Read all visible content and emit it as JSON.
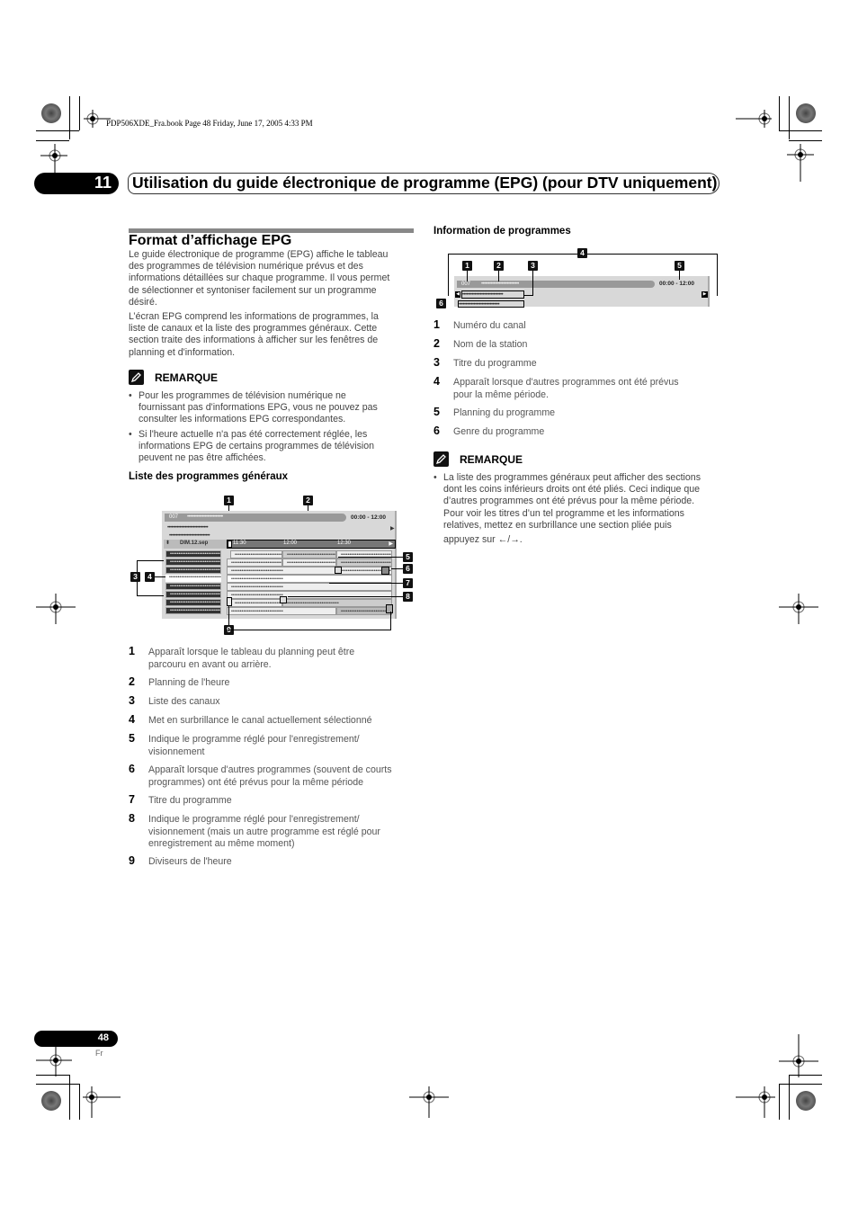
{
  "header": {
    "book_info": "PDP506XDE_Fra.book  Page 48  Friday, June 17, 2005  4:33 PM",
    "chapter_number": "11",
    "chapter_title": "Utilisation du guide électronique de programme (EPG) (pour DTV uniquement)"
  },
  "left": {
    "section_title": "Format d’affichage EPG",
    "intro_lines": [
      "Le guide électronique de programme (EPG) affiche le tableau",
      "des programmes de télévision numérique prévus et des",
      "informations détaillées sur chaque programme. Il vous permet",
      "de sélectionner et syntoniser facilement sur un programme",
      "désiré."
    ],
    "intro2_lines": [
      "L’écran EPG comprend les informations de programmes, la",
      "liste de canaux et la liste des programmes généraux. Cette",
      "section traite des informations à afficher sur les fenêtres de",
      "planning et d'information."
    ],
    "note_label": "REMARQUE",
    "note_bullets": [
      [
        "Pour les programmes de télévision numérique ne",
        "fournissant pas d'informations EPG, vous ne pouvez pas",
        "consulter les informations EPG correspondantes."
      ],
      [
        "Si l'heure actuelle n'a pas été correctement réglée, les",
        "informations EPG de certains programmes de télévision",
        "peuvent ne pas être affichées."
      ]
    ],
    "subhead": "Liste des programmes généraux",
    "diagram": {
      "channel": "007",
      "time_range": "00:00 - 12:00",
      "date": "DIM.12.sep",
      "times": [
        "11:30",
        "12:00",
        "12:30"
      ],
      "dotted": "••••••••••••••••••••••••••••••",
      "callouts": [
        "1",
        "2",
        "3",
        "4",
        "5",
        "6",
        "7",
        "8",
        "9"
      ]
    },
    "items": [
      {
        "num": "1",
        "lines": [
          "Apparaît lorsque le tableau du planning peut être",
          "parcouru en avant ou arrière."
        ]
      },
      {
        "num": "2",
        "lines": [
          "Planning de l'heure"
        ]
      },
      {
        "num": "3",
        "lines": [
          "Liste des canaux"
        ]
      },
      {
        "num": "4",
        "lines": [
          "Met en surbrillance le canal actuellement sélectionné"
        ]
      },
      {
        "num": "5",
        "lines": [
          "Indique le programme réglé pour l'enregistrement/",
          "visionnement"
        ]
      },
      {
        "num": "6",
        "lines": [
          "Apparaît lorsque d'autres programmes (souvent de courts",
          "programmes) ont été prévus pour la même période"
        ]
      },
      {
        "num": "7",
        "lines": [
          "Titre du programme"
        ]
      },
      {
        "num": "8",
        "lines": [
          "Indique le programme réglé pour l'enregistrement/",
          "visionnement (mais un autre programme est réglé pour",
          "enregistrement au même moment)"
        ]
      },
      {
        "num": "9",
        "lines": [
          "Diviseurs de l'heure"
        ]
      }
    ]
  },
  "right": {
    "subhead": "Information de programmes",
    "diagram": {
      "channel": "007",
      "time_range": "00:00 - 12:00",
      "callouts": [
        "1",
        "2",
        "3",
        "4",
        "5",
        "6"
      ]
    },
    "items": [
      {
        "num": "1",
        "lines": [
          "Numéro du canal"
        ]
      },
      {
        "num": "2",
        "lines": [
          "Nom de la station"
        ]
      },
      {
        "num": "3",
        "lines": [
          "Titre du programme"
        ]
      },
      {
        "num": "4",
        "lines": [
          "Apparaît lorsque d'autres programmes ont été prévus",
          "pour la même période."
        ]
      },
      {
        "num": "5",
        "lines": [
          "Planning du programme"
        ]
      },
      {
        "num": "6",
        "lines": [
          "Genre du programme"
        ]
      }
    ],
    "note_label": "REMARQUE",
    "note_lines": [
      "La liste des programmes généraux peut afficher des sections",
      "dont les coins inférieurs droits ont été pliés. Ceci indique que",
      "d’autres programmes ont été prévus pour la même période.",
      "Pour voir les titres d’un tel programme et les informations",
      "relatives, mettez en surbrillance une section pliée puis",
      "appuyez sur ←/→."
    ]
  },
  "footer": {
    "page_number": "48",
    "language": "Fr"
  }
}
